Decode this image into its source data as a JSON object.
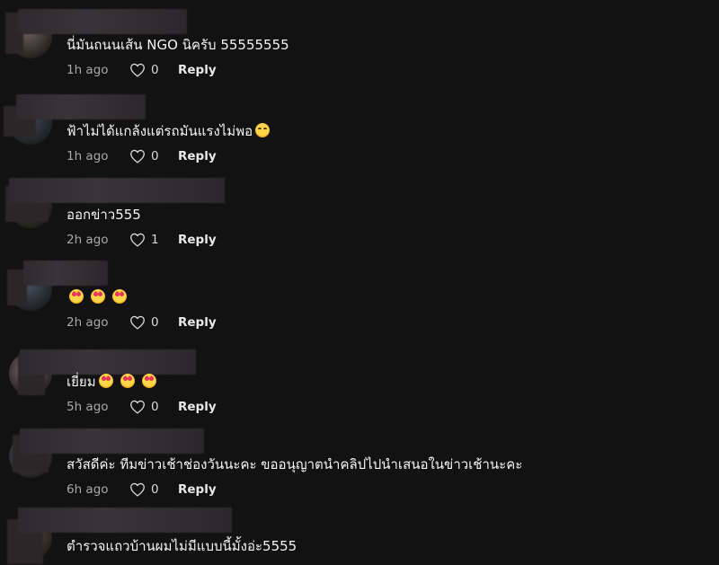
{
  "comments": [
    {
      "text": "นี่มันถนนเส้น NGO นิครับ 55555555",
      "emoji": [],
      "time": "1h ago",
      "likes": "0",
      "reply": "Reply",
      "avatar_color": "#6a5c57"
    },
    {
      "text": "ฟ้าไม่ได้แกล้งแต่รถมันแรงไม่พอ",
      "emoji": [
        "grin"
      ],
      "time": "1h ago",
      "likes": "0",
      "reply": "Reply",
      "avatar_color": "#3d4a5c"
    },
    {
      "text": "ออกข่าว555",
      "emoji": [],
      "time": "2h ago",
      "likes": "1",
      "reply": "Reply",
      "avatar_color": "#4a4438"
    },
    {
      "text": "",
      "emoji": [
        "heart-face",
        "heart-face",
        "heart-face"
      ],
      "time": "2h ago",
      "likes": "0",
      "reply": "Reply",
      "avatar_color": "#43505f"
    },
    {
      "text": "เยี่ยม",
      "emoji": [
        "heart-face",
        "heart-face",
        "heart-face"
      ],
      "time": "5h ago",
      "likes": "0",
      "reply": "Reply",
      "avatar_color": "#8a6d78"
    },
    {
      "text": "สวัสดีค่ะ ทีมข่าวเช้าช่องวันนะคะ ขออนุญาตนำคลิปไปนำเสนอในข่าวเช้านะคะ",
      "emoji": [],
      "time": "6h ago",
      "likes": "0",
      "reply": "Reply",
      "avatar_color": "#5a5a66"
    },
    {
      "text": "ตำรวจแถวบ้านผมไม่มีแบบนี้มั้งอ่ะ5555",
      "emoji": [],
      "time": "",
      "likes": "",
      "reply": "",
      "avatar_color": "#6b5048"
    }
  ]
}
